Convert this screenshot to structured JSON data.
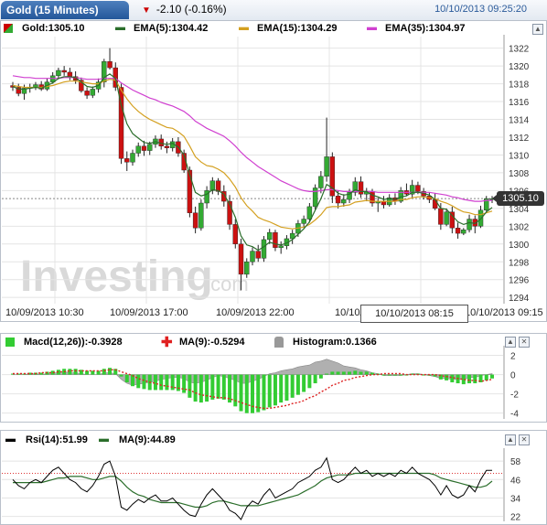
{
  "header": {
    "instrument_tab": "Gold (15 Minutes)",
    "change": "-2.10 (-0.16%)",
    "timestamp": "10/10/2013 09:25:20"
  },
  "main_legend": {
    "price": "Gold:1305.10",
    "ema5": "EMA(5):1304.42",
    "ema15": "EMA(15):1304.29",
    "ema35": "EMA(35):1304.97"
  },
  "watermark": {
    "text": "Investing",
    "suffix": ".com"
  },
  "price_label": "1305.10",
  "crosshair_label": "10/10/2013 08:15",
  "x_labels": [
    "10/09/2013 10:30",
    "10/09/2013 17:00",
    "10/09/2013 22:00",
    "10/10/2013 0",
    "10/10/2013 09:15"
  ],
  "macd_legend": {
    "macd": "Macd(12,26)):-0.3928",
    "ma": "MA(9):-0.5294",
    "histogram": "Histogram:0.1366"
  },
  "rsi_legend": {
    "rsi": "Rsi(14):51.99",
    "ma": "MA(9):44.89"
  },
  "colors": {
    "up": "#33aa33",
    "down": "#cc1111",
    "ema5": "#2b6e2b",
    "ema15": "#d4a020",
    "ema35": "#d040d0",
    "signal": "#dd2222",
    "hist": "#aaaaaa"
  },
  "chart_data": [
    {
      "type": "candlestick",
      "title": "Gold (15 Minutes)",
      "y_ticks": [
        1294,
        1296,
        1298,
        1300,
        1302,
        1304,
        1306,
        1308,
        1310,
        1312,
        1314,
        1316,
        1318,
        1320,
        1322
      ],
      "ylim": [
        1293.3,
        1323.3
      ],
      "candles": [
        [
          1317.8,
          1318.2,
          1317.2,
          1317.6
        ],
        [
          1317.6,
          1318.0,
          1316.6,
          1316.9
        ],
        [
          1316.9,
          1317.9,
          1316.2,
          1317.5
        ],
        [
          1317.5,
          1318.0,
          1317.0,
          1317.6
        ],
        [
          1317.6,
          1318.2,
          1317.3,
          1317.9
        ],
        [
          1317.9,
          1318.3,
          1317.2,
          1317.4
        ],
        [
          1317.4,
          1318.6,
          1317.2,
          1318.2
        ],
        [
          1318.2,
          1319.3,
          1318.0,
          1318.9
        ],
        [
          1318.9,
          1319.8,
          1318.5,
          1319.5
        ],
        [
          1319.5,
          1320.0,
          1318.9,
          1319.3
        ],
        [
          1319.3,
          1319.8,
          1318.4,
          1318.8
        ],
        [
          1318.8,
          1319.4,
          1318.0,
          1318.4
        ],
        [
          1318.4,
          1318.7,
          1317.0,
          1317.2
        ],
        [
          1317.2,
          1317.6,
          1316.3,
          1316.7
        ],
        [
          1316.7,
          1317.7,
          1316.4,
          1317.4
        ],
        [
          1317.4,
          1318.6,
          1317.0,
          1318.2
        ],
        [
          1318.2,
          1320.8,
          1317.6,
          1320.5
        ],
        [
          1320.5,
          1322.0,
          1319.6,
          1319.8
        ],
        [
          1319.8,
          1320.4,
          1317.2,
          1317.6
        ],
        [
          1317.6,
          1318.0,
          1309.0,
          1309.6
        ],
        [
          1309.6,
          1310.4,
          1308.2,
          1309.2
        ],
        [
          1309.2,
          1310.6,
          1308.8,
          1310.2
        ],
        [
          1310.2,
          1311.4,
          1309.8,
          1311.0
        ],
        [
          1311.0,
          1311.6,
          1309.9,
          1310.5
        ],
        [
          1310.5,
          1311.5,
          1310.0,
          1311.2
        ],
        [
          1311.2,
          1312.2,
          1310.8,
          1311.8
        ],
        [
          1311.8,
          1312.3,
          1310.6,
          1311.0
        ],
        [
          1311.0,
          1311.5,
          1310.2,
          1310.8
        ],
        [
          1310.8,
          1311.9,
          1310.4,
          1311.5
        ],
        [
          1311.5,
          1312.0,
          1309.8,
          1310.2
        ],
        [
          1310.2,
          1310.6,
          1308.0,
          1308.3
        ],
        [
          1308.3,
          1308.7,
          1303.0,
          1303.5
        ],
        [
          1303.5,
          1304.2,
          1301.2,
          1301.8
        ],
        [
          1301.8,
          1305.0,
          1301.5,
          1304.6
        ],
        [
          1304.6,
          1306.5,
          1304.0,
          1306.0
        ],
        [
          1306.0,
          1307.5,
          1305.6,
          1307.1
        ],
        [
          1307.1,
          1307.4,
          1305.5,
          1305.9
        ],
        [
          1305.9,
          1306.6,
          1304.2,
          1304.8
        ],
        [
          1304.8,
          1305.5,
          1301.6,
          1302.2
        ],
        [
          1302.2,
          1302.8,
          1299.5,
          1300.0
        ],
        [
          1300.0,
          1300.6,
          1294.8,
          1296.6
        ],
        [
          1296.6,
          1298.4,
          1296.2,
          1298.0
        ],
        [
          1298.0,
          1299.6,
          1297.6,
          1299.2
        ],
        [
          1299.2,
          1299.9,
          1298.0,
          1298.4
        ],
        [
          1298.4,
          1300.9,
          1298.0,
          1300.5
        ],
        [
          1300.5,
          1301.7,
          1300.0,
          1301.3
        ],
        [
          1301.3,
          1301.6,
          1299.2,
          1299.6
        ],
        [
          1299.6,
          1300.3,
          1298.9,
          1299.8
        ],
        [
          1299.8,
          1301.0,
          1299.4,
          1300.6
        ],
        [
          1300.6,
          1301.6,
          1300.0,
          1301.2
        ],
        [
          1301.2,
          1302.7,
          1300.8,
          1302.3
        ],
        [
          1302.3,
          1303.2,
          1301.8,
          1302.8
        ],
        [
          1302.8,
          1304.6,
          1302.4,
          1304.2
        ],
        [
          1304.2,
          1306.7,
          1303.8,
          1306.3
        ],
        [
          1306.3,
          1308.2,
          1305.7,
          1307.6
        ],
        [
          1307.6,
          1314.2,
          1307.0,
          1309.8
        ],
        [
          1309.8,
          1310.3,
          1304.6,
          1305.4
        ],
        [
          1305.4,
          1306.0,
          1304.0,
          1304.6
        ],
        [
          1304.6,
          1305.6,
          1304.2,
          1305.0
        ],
        [
          1305.0,
          1306.2,
          1304.6,
          1305.8
        ],
        [
          1305.8,
          1307.5,
          1305.4,
          1307.0
        ],
        [
          1307.0,
          1307.6,
          1305.2,
          1305.6
        ],
        [
          1305.6,
          1306.3,
          1304.8,
          1305.9
        ],
        [
          1305.9,
          1306.2,
          1304.2,
          1304.6
        ],
        [
          1304.6,
          1305.2,
          1303.6,
          1304.8
        ],
        [
          1304.8,
          1305.4,
          1304.0,
          1304.4
        ],
        [
          1304.4,
          1305.6,
          1304.2,
          1305.2
        ],
        [
          1305.2,
          1305.7,
          1304.4,
          1304.8
        ],
        [
          1304.8,
          1306.4,
          1304.6,
          1306.0
        ],
        [
          1306.0,
          1306.8,
          1305.4,
          1305.6
        ],
        [
          1305.6,
          1307.2,
          1305.2,
          1306.6
        ],
        [
          1306.6,
          1307.0,
          1305.6,
          1305.9
        ],
        [
          1305.9,
          1306.3,
          1305.0,
          1305.4
        ],
        [
          1305.4,
          1305.8,
          1304.6,
          1305.0
        ],
        [
          1305.0,
          1305.7,
          1303.8,
          1304.0
        ],
        [
          1304.0,
          1304.6,
          1301.6,
          1302.2
        ],
        [
          1302.2,
          1304.0,
          1302.0,
          1303.6
        ],
        [
          1303.6,
          1304.2,
          1301.2,
          1301.8
        ],
        [
          1301.8,
          1302.4,
          1300.6,
          1301.2
        ],
        [
          1301.2,
          1301.8,
          1301.0,
          1301.6
        ],
        [
          1301.6,
          1303.3,
          1301.3,
          1302.8
        ],
        [
          1302.8,
          1303.2,
          1301.2,
          1302.0
        ],
        [
          1302.0,
          1304.3,
          1301.8,
          1303.8
        ],
        [
          1303.8,
          1305.4,
          1303.6,
          1305.1
        ],
        [
          1305.1,
          1305.4,
          1304.6,
          1305.1
        ]
      ],
      "ema5": [
        1317.7,
        1317.4,
        1317.4,
        1317.5,
        1317.6,
        1317.5,
        1317.8,
        1318.1,
        1318.6,
        1318.8,
        1318.8,
        1318.7,
        1318.2,
        1317.7,
        1317.6,
        1317.8,
        1318.7,
        1319.1,
        1318.6,
        1315.6,
        1313.5,
        1312.4,
        1311.9,
        1311.4,
        1311.3,
        1311.5,
        1311.3,
        1311.2,
        1311.3,
        1310.9,
        1310.0,
        1307.8,
        1305.8,
        1305.4,
        1305.6,
        1306.1,
        1306.0,
        1305.6,
        1304.5,
        1303.0,
        1300.9,
        1299.9,
        1299.7,
        1299.3,
        1299.7,
        1300.2,
        1300.0,
        1299.9,
        1300.1,
        1300.5,
        1301.1,
        1301.7,
        1302.5,
        1303.8,
        1305.1,
        1306.7,
        1306.3,
        1305.7,
        1305.5,
        1305.6,
        1306.1,
        1305.9,
        1305.9,
        1305.5,
        1305.3,
        1305.0,
        1305.1,
        1305.0,
        1305.3,
        1305.4,
        1305.8,
        1305.8,
        1305.7,
        1305.5,
        1305.0,
        1304.0,
        1303.9,
        1303.2,
        1302.5,
        1302.2,
        1302.4,
        1302.3,
        1302.8,
        1303.6,
        1304.1
      ],
      "ema15": [
        1317.8,
        1317.7,
        1317.6,
        1317.6,
        1317.6,
        1317.6,
        1317.7,
        1317.8,
        1318.0,
        1318.2,
        1318.3,
        1318.3,
        1318.2,
        1318.1,
        1318.0,
        1318.0,
        1318.3,
        1318.5,
        1318.4,
        1317.3,
        1316.3,
        1315.5,
        1314.9,
        1314.4,
        1314.0,
        1313.7,
        1313.4,
        1313.1,
        1313.0,
        1312.6,
        1312.1,
        1311.0,
        1309.8,
        1309.2,
        1308.8,
        1308.7,
        1308.4,
        1308.0,
        1307.3,
        1306.4,
        1305.2,
        1304.3,
        1303.7,
        1303.0,
        1302.7,
        1302.5,
        1302.2,
        1301.9,
        1301.8,
        1301.7,
        1301.8,
        1301.9,
        1302.2,
        1302.7,
        1303.3,
        1304.1,
        1304.2,
        1304.2,
        1304.3,
        1304.4,
        1304.7,
        1304.8,
        1304.9,
        1304.8,
        1304.8,
        1304.8,
        1304.8,
        1304.8,
        1305.0,
        1305.0,
        1305.2,
        1305.3,
        1305.3,
        1305.2,
        1305.1,
        1304.8,
        1304.6,
        1304.3,
        1303.9,
        1303.6,
        1303.5,
        1303.3,
        1303.3,
        1303.5,
        1303.7
      ],
      "ema35": [
        1318.9,
        1318.8,
        1318.7,
        1318.7,
        1318.6,
        1318.6,
        1318.6,
        1318.6,
        1318.6,
        1318.7,
        1318.7,
        1318.7,
        1318.6,
        1318.5,
        1318.5,
        1318.5,
        1318.6,
        1318.6,
        1318.6,
        1318.1,
        1317.7,
        1317.3,
        1317.0,
        1316.7,
        1316.4,
        1316.2,
        1315.9,
        1315.7,
        1315.5,
        1315.2,
        1314.9,
        1314.4,
        1313.8,
        1313.4,
        1313.0,
        1312.7,
        1312.4,
        1312.1,
        1311.6,
        1311.0,
        1310.3,
        1309.7,
        1309.2,
        1308.7,
        1308.3,
        1307.9,
        1307.5,
        1307.1,
        1306.8,
        1306.5,
        1306.2,
        1306.0,
        1305.9,
        1305.9,
        1306.0,
        1306.1,
        1306.1,
        1306.0,
        1305.9,
        1305.9,
        1305.9,
        1305.9,
        1305.9,
        1305.9,
        1305.8,
        1305.8,
        1305.8,
        1305.8,
        1305.8,
        1305.8,
        1305.8,
        1305.8,
        1305.8,
        1305.8,
        1305.7,
        1305.6,
        1305.5,
        1305.3,
        1305.2,
        1305.0,
        1304.9,
        1304.8,
        1304.8,
        1304.9,
        1304.9
      ]
    },
    {
      "type": "bar",
      "title": "Macd(12,26)",
      "y_ticks": [
        2,
        0,
        -2,
        -4
      ],
      "ylim": [
        -4.6,
        3.0
      ],
      "macd": [
        0.1,
        0.1,
        0.1,
        0.2,
        0.2,
        0.2,
        0.3,
        0.4,
        0.5,
        0.6,
        0.6,
        0.6,
        0.5,
        0.4,
        0.4,
        0.4,
        0.6,
        0.7,
        0.6,
        -0.2,
        -0.8,
        -1.2,
        -1.4,
        -1.5,
        -1.6,
        -1.6,
        -1.6,
        -1.6,
        -1.6,
        -1.7,
        -1.9,
        -2.4,
        -2.8,
        -2.9,
        -2.8,
        -2.6,
        -2.5,
        -2.6,
        -2.9,
        -3.3,
        -3.8,
        -4.0,
        -4.0,
        -3.9,
        -3.7,
        -3.4,
        -3.2,
        -2.9,
        -2.7,
        -2.4,
        -2.1,
        -1.8,
        -1.4,
        -0.9,
        -0.4,
        0.1,
        0.3,
        0.3,
        0.3,
        0.3,
        0.4,
        0.3,
        0.3,
        0.2,
        0.1,
        0.0,
        0.0,
        0.0,
        0.0,
        0.0,
        0.1,
        0.1,
        0.0,
        -0.1,
        -0.2,
        -0.5,
        -0.6,
        -0.8,
        -0.9,
        -1.0,
        -0.9,
        -0.9,
        -0.8,
        -0.6,
        -0.4
      ],
      "signal": [
        0.1,
        0.1,
        0.1,
        0.1,
        0.1,
        0.2,
        0.2,
        0.2,
        0.3,
        0.3,
        0.4,
        0.4,
        0.4,
        0.4,
        0.4,
        0.4,
        0.4,
        0.5,
        0.5,
        0.3,
        0.1,
        -0.1,
        -0.4,
        -0.6,
        -0.8,
        -0.9,
        -1.1,
        -1.2,
        -1.3,
        -1.4,
        -1.5,
        -1.6,
        -1.9,
        -2.1,
        -2.2,
        -2.3,
        -2.4,
        -2.4,
        -2.5,
        -2.7,
        -2.9,
        -3.1,
        -3.3,
        -3.4,
        -3.5,
        -3.5,
        -3.4,
        -3.3,
        -3.2,
        -3.0,
        -2.9,
        -2.7,
        -2.4,
        -2.2,
        -1.8,
        -1.5,
        -1.1,
        -0.9,
        -0.6,
        -0.5,
        -0.3,
        -0.2,
        -0.1,
        0.0,
        0.0,
        0.1,
        0.1,
        0.1,
        0.1,
        0.0,
        0.0,
        0.0,
        0.0,
        0.0,
        0.0,
        -0.1,
        -0.2,
        -0.3,
        -0.4,
        -0.5,
        -0.6,
        -0.6,
        -0.7,
        -0.6,
        -0.5
      ]
    },
    {
      "type": "line",
      "title": "Rsi(14)",
      "y_ticks": [
        58,
        46,
        34,
        22
      ],
      "ylim": [
        20,
        64
      ],
      "reference_line": 50,
      "rsi": [
        46,
        42,
        40,
        44,
        46,
        44,
        48,
        52,
        54,
        50,
        46,
        44,
        40,
        38,
        42,
        48,
        56,
        58,
        48,
        28,
        26,
        30,
        33,
        31,
        34,
        36,
        32,
        32,
        34,
        30,
        26,
        23,
        22,
        30,
        36,
        40,
        36,
        32,
        26,
        24,
        20,
        28,
        32,
        30,
        36,
        40,
        34,
        36,
        38,
        40,
        44,
        46,
        48,
        52,
        54,
        60,
        46,
        44,
        46,
        50,
        54,
        50,
        52,
        48,
        50,
        48,
        50,
        48,
        52,
        50,
        54,
        50,
        48,
        46,
        42,
        36,
        42,
        36,
        34,
        36,
        42,
        38,
        46,
        52,
        52
      ],
      "ma": [
        44,
        44,
        44,
        44,
        44,
        44,
        45,
        46,
        47,
        47,
        48,
        48,
        48,
        47,
        46,
        46,
        47,
        48,
        48,
        45,
        41,
        38,
        36,
        35,
        33,
        32,
        31,
        31,
        31,
        31,
        30,
        29,
        28,
        28,
        29,
        31,
        32,
        32,
        31,
        30,
        29,
        29,
        29,
        29,
        30,
        31,
        32,
        33,
        34,
        35,
        36,
        38,
        40,
        42,
        45,
        47,
        48,
        49,
        49,
        49,
        50,
        50,
        50,
        50,
        50,
        50,
        50,
        50,
        50,
        50,
        50,
        50,
        50,
        50,
        49,
        47,
        46,
        45,
        44,
        43,
        42,
        41,
        41,
        42,
        45
      ]
    }
  ]
}
